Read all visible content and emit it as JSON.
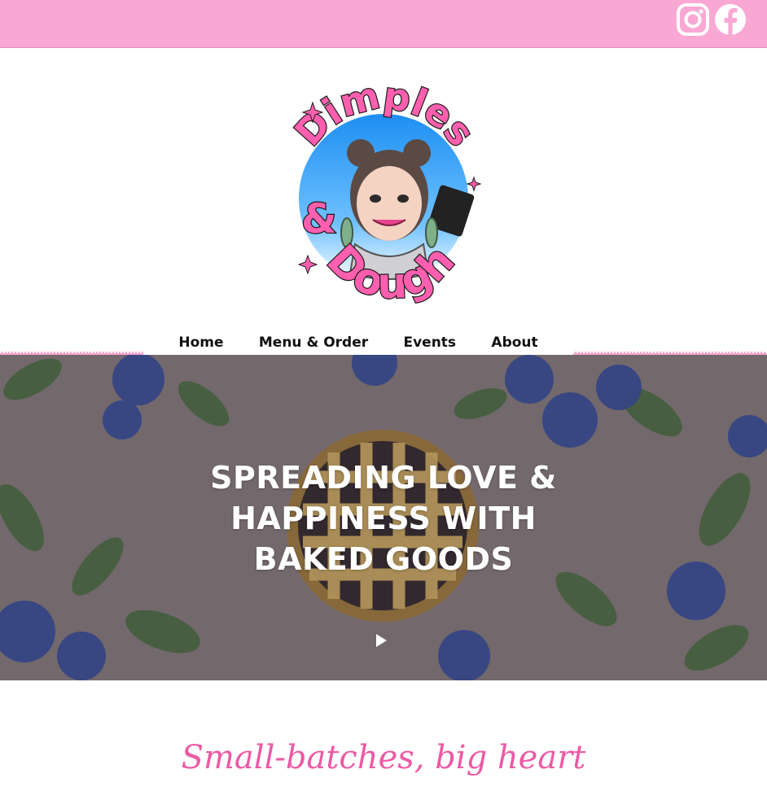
{
  "header": {
    "social": [
      {
        "icon": "instagram-icon"
      },
      {
        "icon": "facebook-icon"
      }
    ]
  },
  "logo": {
    "word1": "Dimples",
    "amp": "&",
    "word2": "Dough"
  },
  "nav": {
    "items": [
      {
        "label": "Home"
      },
      {
        "label": "Menu & Order"
      },
      {
        "label": "Events"
      },
      {
        "label": "About"
      }
    ]
  },
  "hero": {
    "line1": "SPREADING LOVE &",
    "line2": "HAPPINESS WITH",
    "line3": "BAKED GOODS",
    "play_icon": "play-icon"
  },
  "tagline": "Small-batches, big heart",
  "colors": {
    "topbar": "#f9a8d4",
    "brand_pink": "#ec5aa5",
    "hero_overlay": "#7c6f73"
  }
}
